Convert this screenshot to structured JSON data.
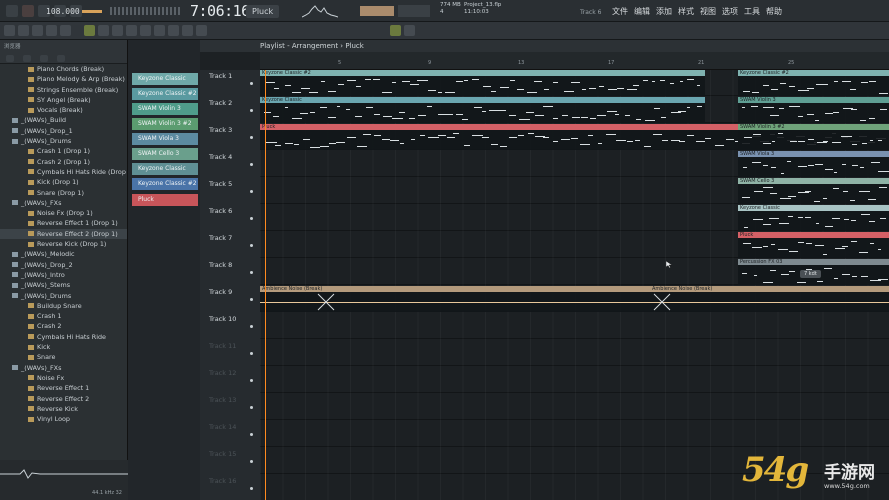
{
  "topbar": {
    "tempo": "108.000",
    "time": "7:06:16",
    "pattern": "Pluck",
    "mem": "774 MB",
    "cpu": "4",
    "project": "Project_13.flp",
    "clock": "11:10:03",
    "track_info": "Track 6",
    "menus": [
      "文件",
      "编辑",
      "添加",
      "样式",
      "视图",
      "选项",
      "工具",
      "帮助"
    ]
  },
  "browser": {
    "header": "浏览器",
    "items": [
      {
        "label": "Piano Chords (Break)",
        "type": "file"
      },
      {
        "label": "Piano Melody & Arp (Break)",
        "type": "file"
      },
      {
        "label": "Strings Ensemble (Break)",
        "type": "file"
      },
      {
        "label": "SY Angel (Break)",
        "type": "file"
      },
      {
        "label": "Vocals (Break)",
        "type": "file"
      },
      {
        "label": "_(WAVs)_Build",
        "type": "folder"
      },
      {
        "label": "_(WAVs)_Drop_1",
        "type": "folder"
      },
      {
        "label": "_(WAVs)_Drums",
        "type": "folder"
      },
      {
        "label": "Crash 1 (Drop 1)",
        "type": "file"
      },
      {
        "label": "Crash 2 (Drop 1)",
        "type": "file"
      },
      {
        "label": "Cymbals Hi Hats Ride (Drop 1)",
        "type": "file"
      },
      {
        "label": "Kick (Drop 1)",
        "type": "file"
      },
      {
        "label": "Snare (Drop 1)",
        "type": "file"
      },
      {
        "label": "_(WAVs)_FXs",
        "type": "folder"
      },
      {
        "label": "Noise Fx (Drop 1)",
        "type": "file"
      },
      {
        "label": "Reverse Effect 1 (Drop 1)",
        "type": "file"
      },
      {
        "label": "Reverse Effect 2 (Drop 1)",
        "type": "file",
        "selected": true
      },
      {
        "label": "Reverse Kick (Drop 1)",
        "type": "file"
      },
      {
        "label": "_(WAVs)_Melodic",
        "type": "folder"
      },
      {
        "label": "_(WAVs)_Drop_2",
        "type": "folder"
      },
      {
        "label": "_(WAVs)_Intro",
        "type": "folder"
      },
      {
        "label": "_(WAVs)_Stems",
        "type": "folder"
      },
      {
        "label": "_(WAVs)_Drums",
        "type": "folder"
      },
      {
        "label": "Buildup Snare",
        "type": "file"
      },
      {
        "label": "Crash 1",
        "type": "file"
      },
      {
        "label": "Crash 2",
        "type": "file"
      },
      {
        "label": "Cymbals  Hi Hats  Ride",
        "type": "file"
      },
      {
        "label": "Kick",
        "type": "file"
      },
      {
        "label": "Snare",
        "type": "file"
      },
      {
        "label": "_(WAVs)_FXs",
        "type": "folder"
      },
      {
        "label": "Noise Fx",
        "type": "file"
      },
      {
        "label": "Reverse Effect 1",
        "type": "file"
      },
      {
        "label": "Reverse Effect 2",
        "type": "file"
      },
      {
        "label": "Reverse Kick",
        "type": "file"
      },
      {
        "label": "Vinyl Loop",
        "type": "file"
      }
    ],
    "footer": "44.1 kHz 32"
  },
  "patterns": [
    {
      "label": "Keyzone Classic",
      "color": "#6fa8a8"
    },
    {
      "label": "Keyzone Classic #2",
      "color": "#5a9aa0"
    },
    {
      "label": "SWAM Violin 3",
      "color": "#4f9c8a"
    },
    {
      "label": "SWAM Violin 3 #2",
      "color": "#5b9c70"
    },
    {
      "label": "SWAM Viola 3",
      "color": "#5c8aa0"
    },
    {
      "label": "SWAM Cello 3",
      "color": "#6a9f8c"
    },
    {
      "label": "Keyzone Classic",
      "color": "#5f8f94"
    },
    {
      "label": "Keyzone Classic #2",
      "color": "#4a74a8"
    },
    {
      "label": "Pluck",
      "color": "#c8555a"
    }
  ],
  "playlist": {
    "title": "Playlist - Arrangement",
    "pattern": "Pluck",
    "ruler": [
      "5",
      "9",
      "13",
      "17",
      "21",
      "25"
    ],
    "tracks": [
      "Track 1",
      "Track 2",
      "Track 3",
      "Track 4",
      "Track 5",
      "Track 6",
      "Track 7",
      "Track 8",
      "Track 9",
      "Track 10",
      "Track 11",
      "Track 12",
      "Track 13",
      "Track 14",
      "Track 15",
      "Track 16"
    ],
    "clips": [
      {
        "label": "Keyzone Classic #2",
        "color": "#7fb2b0"
      },
      {
        "label": "Keyzone Classic",
        "color": "#6aa6b0"
      },
      {
        "label": "Pluck",
        "color": "#d46066"
      },
      {
        "label": "Keyzone Classic #2",
        "color": "#7fb2b0"
      },
      {
        "label": "SWAM Violin 3",
        "color": "#5f9f94"
      },
      {
        "label": "SWAM Violin 3 #2",
        "color": "#6fa37a"
      },
      {
        "label": "SWAM Viola 3",
        "color": "#7a92b0"
      },
      {
        "label": "SWAM Cello 3",
        "color": "#8fb3a6"
      },
      {
        "label": "Keyzone Classic",
        "color": "#a8c4c4"
      },
      {
        "label": "Pluck",
        "color": "#d46066"
      },
      {
        "label": "Percussion FX 03",
        "color": "#7e8a90"
      },
      {
        "label": "Ambience Noise (Break)",
        "color": "#b39a7c"
      },
      {
        "label": "Ambience Noise (Break)",
        "color": "#b39a7c"
      }
    ],
    "badge": "7 kdt"
  },
  "watermark": {
    "brand": "54g",
    "site": "手游网",
    "url": "www.54g.com"
  }
}
